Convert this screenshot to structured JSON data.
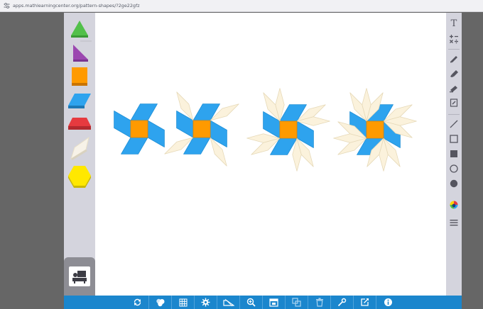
{
  "browser": {
    "url": "apps.mathlearningcenter.org/pattern-shapes/?2ge22gfz"
  },
  "colors": {
    "accent": "#1b86cd",
    "tray": "#d4d4dd",
    "hexagon": "#ffe800",
    "square": "#ff9a00",
    "trapezoid": "#e63a3f",
    "rhombus_blue": "#2ea3ee",
    "rhombus_tan": "#fbf2dc",
    "triangle": "#52c04a",
    "right_triangle": "#9b47b0"
  },
  "shape_tray": [
    {
      "name": "triangle-shape",
      "icon": "green-triangle"
    },
    {
      "name": "right-triangle-shape",
      "icon": "purple-right-triangle"
    },
    {
      "name": "square-shape",
      "icon": "orange-square"
    },
    {
      "name": "rhombus-shape",
      "icon": "blue-rhombus"
    },
    {
      "name": "trapezoid-shape",
      "icon": "red-trapezoid"
    },
    {
      "name": "thin-rhombus-shape",
      "icon": "tan-thin-rhombus"
    },
    {
      "name": "hexagon-shape",
      "icon": "yellow-hexagon"
    }
  ],
  "right_toolbar": {
    "text_tool": "T",
    "tools": [
      "text-tool",
      "math-symbols-tool",
      "pen-tool",
      "marker-tool",
      "highlighter-tool",
      "eraser-tool",
      "line-tool",
      "rectangle-outline-tool",
      "rectangle-filled-tool",
      "circle-outline-tool",
      "circle-filled-tool",
      "color-picker-tool",
      "menu-tool"
    ]
  },
  "bottom_toolbar": [
    "rotate-icon",
    "duplicate-icon",
    "grid-icon",
    "settings-icon",
    "flip-icon",
    "zoom-in-icon",
    "screenshot-icon",
    "copy-icon",
    "trash-icon",
    "link-icon",
    "share-icon",
    "info-icon"
  ],
  "pattern": {
    "figures": [
      {
        "label": "figure-1",
        "tan_arms": 0
      },
      {
        "label": "figure-2",
        "tan_arms": 4
      },
      {
        "label": "figure-3",
        "tan_arms": 8
      },
      {
        "label": "figure-4",
        "tan_arms": 12
      }
    ]
  }
}
